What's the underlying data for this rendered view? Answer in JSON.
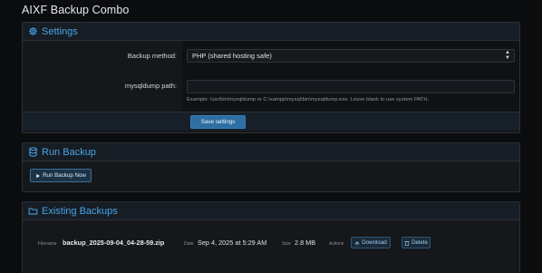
{
  "page": {
    "title": "AIXF Backup Combo"
  },
  "settings": {
    "header": "Settings",
    "icon": "gear-icon",
    "backup_method_label": "Backup method:",
    "backup_method_value": "PHP (shared hosting safe)",
    "mysqldump_label": "mysqldump path:",
    "mysqldump_value": "",
    "mysqldump_hint": "Example: /usr/bin/mysqldump or C:\\xampp\\mysql\\bin\\mysqldump.exe. Leave blank to use system PATH.",
    "save_label": "Save settings"
  },
  "run_backup": {
    "header": "Run Backup",
    "icon": "database-icon",
    "button_label": "Run Backup Now",
    "button_icon": "play-icon"
  },
  "existing_backups": {
    "header": "Existing Backups",
    "icon": "folder-icon",
    "rows": [
      {
        "filename_label": "Filename",
        "filename": "backup_2025-09-04_04-28-59.zip",
        "date_label": "Date",
        "date": "Sep 4, 2025 at 5:29 AM",
        "size_label": "Size",
        "size": "2.8 MB",
        "actions_label": "Actions",
        "download_label": "Download",
        "download_icon": "download-icon",
        "delete_label": "Delete",
        "delete_icon": "trash-icon"
      }
    ]
  },
  "colors": {
    "accent": "#4aa3e5",
    "primary_button": "#2d6fa3",
    "background": "#0b0c0e"
  }
}
